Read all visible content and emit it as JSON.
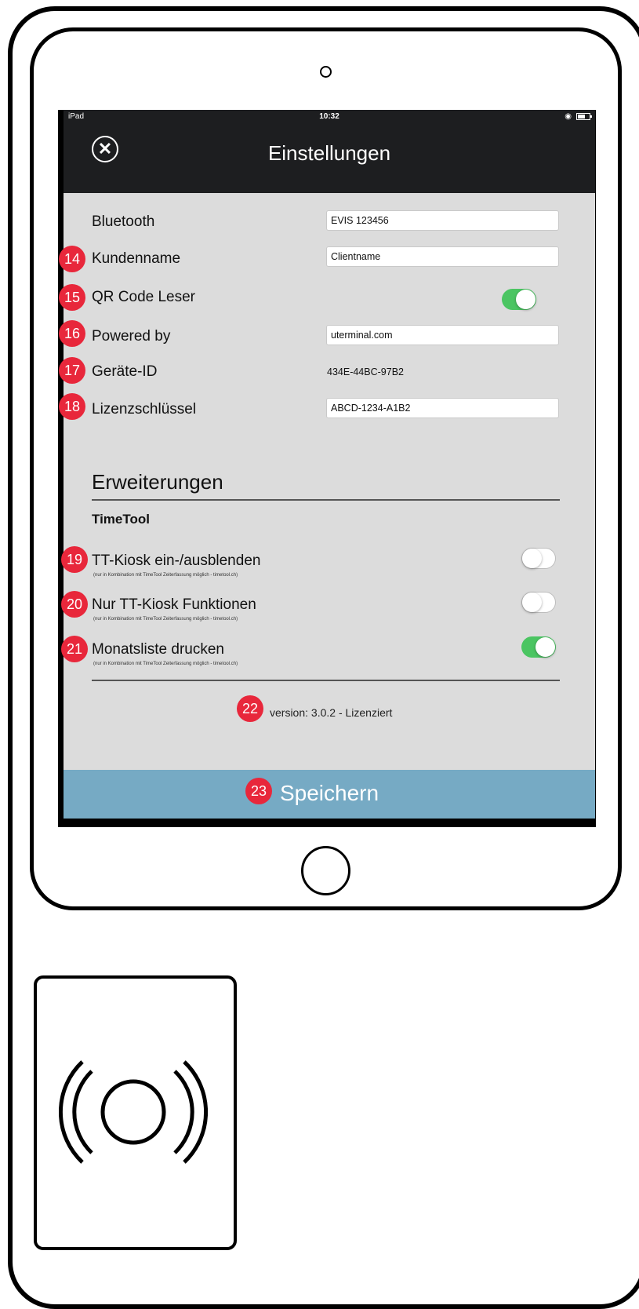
{
  "status_bar": {
    "device": "iPad",
    "time": "10:32"
  },
  "header": {
    "title": "Einstellungen",
    "close_icon": "close-icon"
  },
  "settings": {
    "bluetooth": {
      "label": "Bluetooth",
      "value": "EVIS 123456"
    },
    "customer_name": {
      "label": "Kundenname",
      "value": "Clientname"
    },
    "qr_reader": {
      "label": "QR Code Leser",
      "enabled": true
    },
    "powered_by": {
      "label": "Powered by",
      "value": "uterminal.com"
    },
    "device_id": {
      "label": "Geräte-ID",
      "value": "434E-44BC-97B2"
    },
    "license_key": {
      "label": "Lizenzschlüssel",
      "value": "ABCD-1234-A1B2"
    }
  },
  "extensions": {
    "title": "Erweiterungen",
    "subsection": "TimeTool",
    "options": [
      {
        "label": "TT-Kiosk ein-/ausblenden",
        "note": "(nur in Kombination mit TimeTool Zeiterfassung möglich - timetool.ch)",
        "enabled": false
      },
      {
        "label": "Nur TT-Kiosk Funktionen",
        "note": "(nur in Kombination mit TimeTool Zeiterfassung möglich - timetool.ch)",
        "enabled": false
      },
      {
        "label": "Monatsliste drucken",
        "note": "(nur in Kombination mit TimeTool Zeiterfassung möglich - timetool.ch)",
        "enabled": true
      }
    ]
  },
  "version": "version: 3.0.2 - Lizenziert",
  "save_button": {
    "label": "Speichern"
  },
  "badges": [
    "14",
    "15",
    "16",
    "17",
    "18",
    "19",
    "20",
    "21",
    "22",
    "23"
  ],
  "colors": {
    "header": "#1d1e20",
    "content": "#dcdcdc",
    "save": "#76aac4",
    "toggle_on": "#4bc562",
    "badge": "#e8273b"
  }
}
